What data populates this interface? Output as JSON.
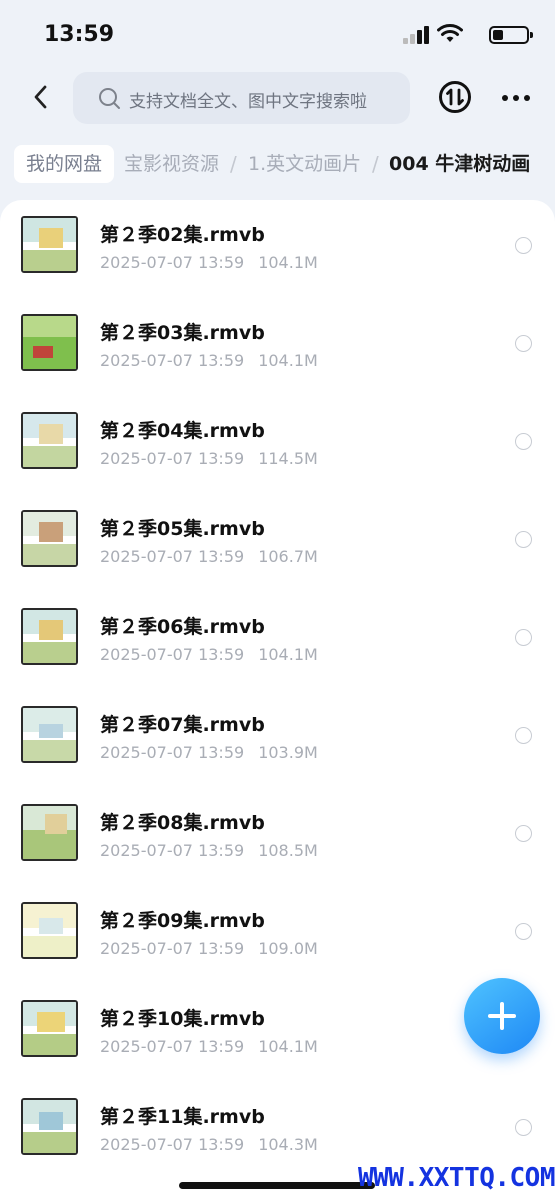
{
  "status_bar": {
    "time": "13:59"
  },
  "top_bar": {
    "search_placeholder": "支持文档全文、图中文字搜索啦"
  },
  "breadcrumb": {
    "root": "我的网盘",
    "items": [
      "宝影视资源",
      "1.英文动画片",
      "004 牛津树动画"
    ],
    "separator": "/"
  },
  "files": [
    {
      "name": "第２季02集.rmvb",
      "date": "2025-07-07 13:59",
      "size": "104.1M"
    },
    {
      "name": "第２季03集.rmvb",
      "date": "2025-07-07 13:59",
      "size": "104.1M"
    },
    {
      "name": "第２季04集.rmvb",
      "date": "2025-07-07 13:59",
      "size": "114.5M"
    },
    {
      "name": "第２季05集.rmvb",
      "date": "2025-07-07 13:59",
      "size": "106.7M"
    },
    {
      "name": "第２季06集.rmvb",
      "date": "2025-07-07 13:59",
      "size": "104.1M"
    },
    {
      "name": "第２季07集.rmvb",
      "date": "2025-07-07 13:59",
      "size": "103.9M"
    },
    {
      "name": "第２季08集.rmvb",
      "date": "2025-07-07 13:59",
      "size": "108.5M"
    },
    {
      "name": "第２季09集.rmvb",
      "date": "2025-07-07 13:59",
      "size": "109.0M"
    },
    {
      "name": "第２季10集.rmvb",
      "date": "2025-07-07 13:59",
      "size": "104.1M"
    },
    {
      "name": "第２季11集.rmvb",
      "date": "2025-07-07 13:59",
      "size": "104.3M"
    }
  ],
  "watermark": "WWW.XXTTQ.COM",
  "colors": {
    "accent": "#1e88f5",
    "watermark": "#1433e0"
  }
}
